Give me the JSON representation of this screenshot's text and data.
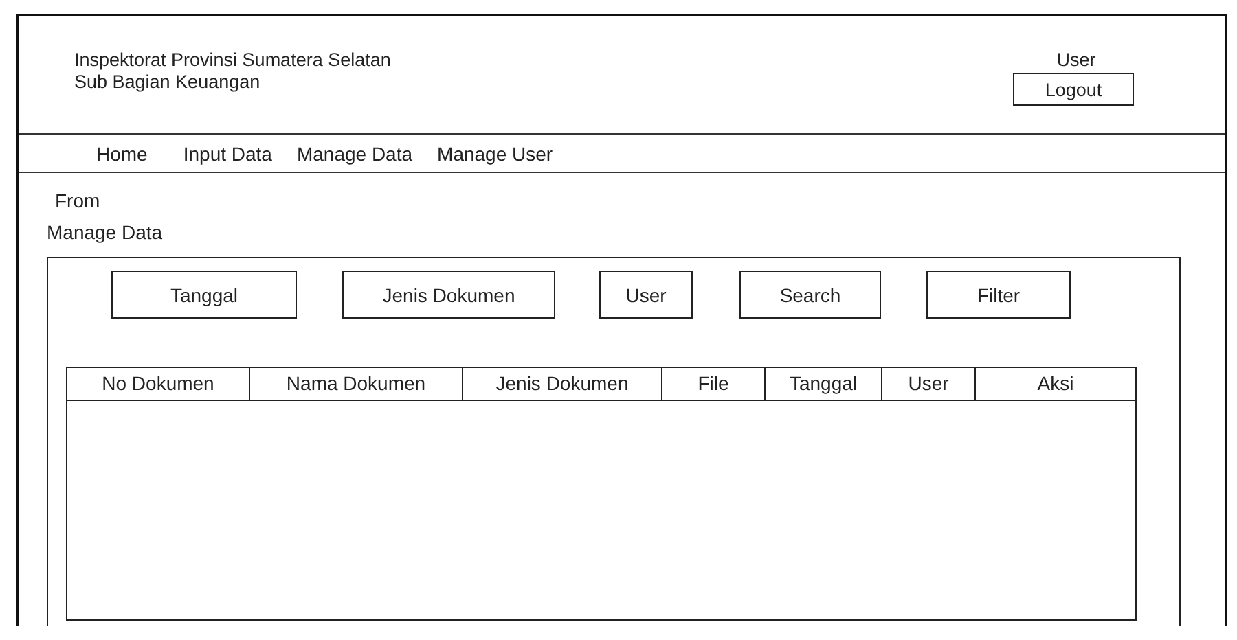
{
  "header": {
    "title_lines": [
      "Inspektorat Provinsi Sumatera Selatan",
      "Sub Bagian Keuangan"
    ],
    "user": "User",
    "logout": "Logout"
  },
  "nav": [
    "Home",
    "Input Data",
    "Manage Data",
    "Manage User"
  ],
  "form_label": [
    "From",
    "Manage Data"
  ],
  "filters": [
    "Tanggal",
    "Jenis Dokumen",
    "User",
    "Search",
    "Filter"
  ],
  "table": {
    "columns": [
      "No Dokumen",
      "Nama Dokumen",
      "Jenis Dokumen",
      "File",
      "Tanggal",
      "User",
      "Aksi"
    ]
  }
}
